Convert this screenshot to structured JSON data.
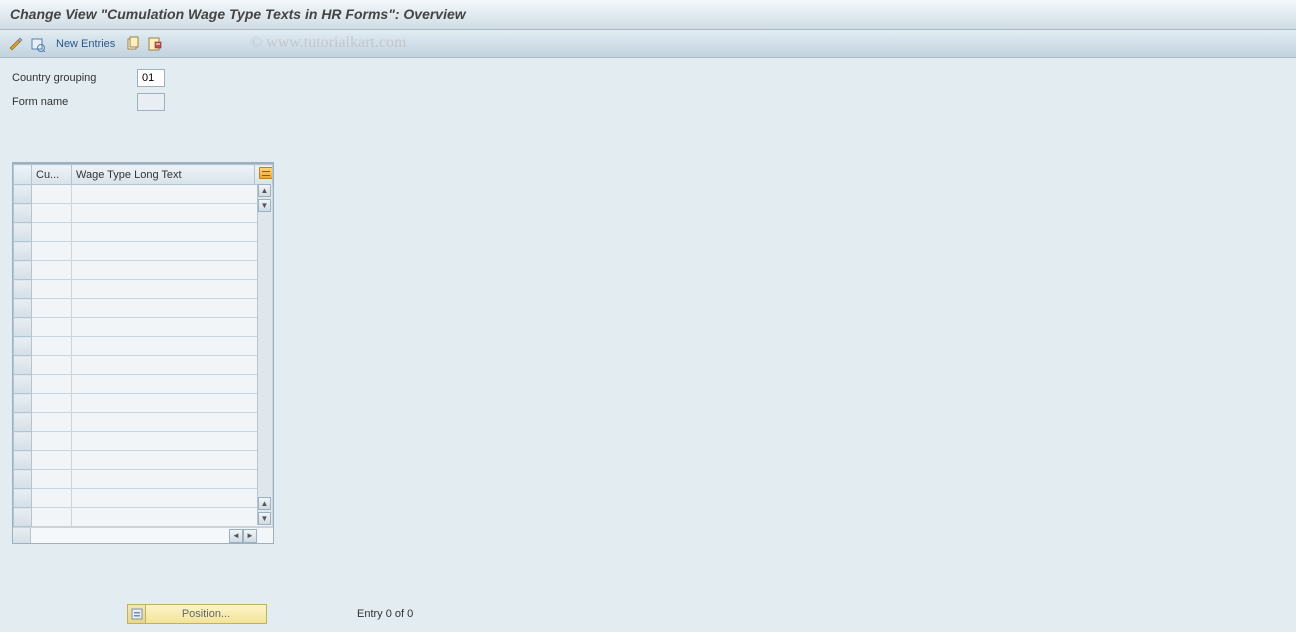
{
  "header": {
    "title": "Change View \"Cumulation Wage Type Texts in HR Forms\": Overview"
  },
  "toolbar": {
    "new_entries_label": "New Entries"
  },
  "watermark": "© www.tutorialkart.com",
  "form": {
    "country_grouping_label": "Country grouping",
    "country_grouping_value": "01",
    "form_name_label": "Form name",
    "form_name_value": ""
  },
  "table": {
    "columns": {
      "cu": "Cu...",
      "wage_type": "Wage Type Long Text"
    },
    "row_count": 18
  },
  "footer": {
    "position_label": "Position...",
    "entry_text": "Entry 0 of 0"
  }
}
